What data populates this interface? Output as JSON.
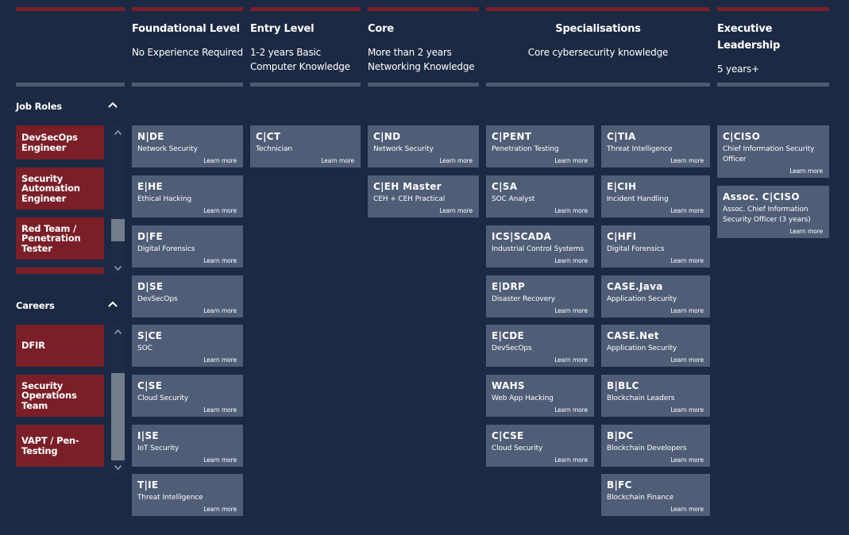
{
  "columns": [
    {
      "title": "Foundational Level",
      "subtitle_lines": [
        "No Experience Required"
      ]
    },
    {
      "title": "Entry Level",
      "subtitle_lines": [
        "1-2 years Basic",
        "Computer Knowledge"
      ]
    },
    {
      "title": "Core",
      "subtitle_lines": [
        "More than 2 years",
        "Networking Knowledge"
      ]
    },
    {
      "title": "Specialisations",
      "subtitle_lines": [
        "Core cybersecurity knowledge"
      ]
    },
    {
      "title_lines": [
        "Executive",
        "Leadership"
      ],
      "subtitle_lines": [
        "5 years+"
      ]
    }
  ],
  "sidebar": {
    "job_roles": {
      "label": "Job Roles",
      "icon": "chevron-up-icon",
      "items": [
        {
          "lines": [
            "DevSecOps",
            "Engineer"
          ]
        },
        {
          "lines": [
            "Security",
            "Automation",
            "Engineer"
          ]
        },
        {
          "lines": [
            "Red Team /",
            "Penetration",
            "Tester"
          ]
        },
        {
          "lines": [
            ""
          ]
        }
      ]
    },
    "careers": {
      "label": "Careers",
      "icon": "chevron-up-icon",
      "items": [
        {
          "lines": [
            "DFIR"
          ]
        },
        {
          "lines": [
            "Security",
            "Operations",
            "Team"
          ]
        },
        {
          "lines": [
            "VAPT / Pen-",
            "Testing"
          ]
        }
      ]
    }
  },
  "learn_more_label": "Learn more",
  "cards": {
    "foundational": [
      {
        "code": "N|DE",
        "desc": "Network Security"
      },
      {
        "code": "E|HE",
        "desc": "Ethical Hacking"
      },
      {
        "code": "D|FE",
        "desc": "Digital Forensics"
      },
      {
        "code": "D|SE",
        "desc": "DevSecOps"
      },
      {
        "code": "S|CE",
        "desc": "SOC"
      },
      {
        "code": "C|SE",
        "desc": "Cloud Security"
      },
      {
        "code": "I|SE",
        "desc": "IoT Security"
      },
      {
        "code": "T|IE",
        "desc": "Threat Intelligence"
      }
    ],
    "entry": [
      {
        "code": "C|CT",
        "desc": "Technician"
      }
    ],
    "core": [
      {
        "code": "C|ND",
        "desc": "Network Security"
      },
      {
        "code": "C|EH Master",
        "desc": "CEH + CEH Practical"
      }
    ],
    "spec_a": [
      {
        "code": "C|PENT",
        "desc": "Penetration Testing"
      },
      {
        "code": "C|SA",
        "desc": "SOC Analyst"
      },
      {
        "code": "ICS|SCADA",
        "desc": "Industrial Control Systems"
      },
      {
        "code": "E|DRP",
        "desc": "Disaster Recovery"
      },
      {
        "code": "E|CDE",
        "desc": "DevSecOps"
      },
      {
        "code": "WAHS",
        "desc": "Web App Hacking"
      },
      {
        "code": "C|CSE",
        "desc": "Cloud Security"
      }
    ],
    "spec_b": [
      {
        "code": "C|TIA",
        "desc": "Threat Intelligence"
      },
      {
        "code": "E|CIH",
        "desc": "Incident Handling"
      },
      {
        "code": "C|HFI",
        "desc": "Digital Forensics"
      },
      {
        "code": "CASE.Java",
        "desc": "Application Security"
      },
      {
        "code": "CASE.Net",
        "desc": "Application Security"
      },
      {
        "code": "B|BLC",
        "desc": "Blockchain Leaders"
      },
      {
        "code": "B|DC",
        "desc": "Blockchain Developers"
      },
      {
        "code": "B|FC",
        "desc": "Blockchain Finance"
      }
    ],
    "executive": [
      {
        "code": "C|CISO",
        "desc_lines": [
          "Chief Information Security",
          "Officer"
        ]
      },
      {
        "code": "Assoc. C|CISO",
        "desc_lines": [
          "Assoc. Chief Information",
          "Security Officer (3 years)"
        ]
      }
    ]
  },
  "colors": {
    "background": "#1c2942",
    "accent_red": "#7a1f2a",
    "card": "#505d77",
    "scroll_thumb": "#737d8e"
  }
}
